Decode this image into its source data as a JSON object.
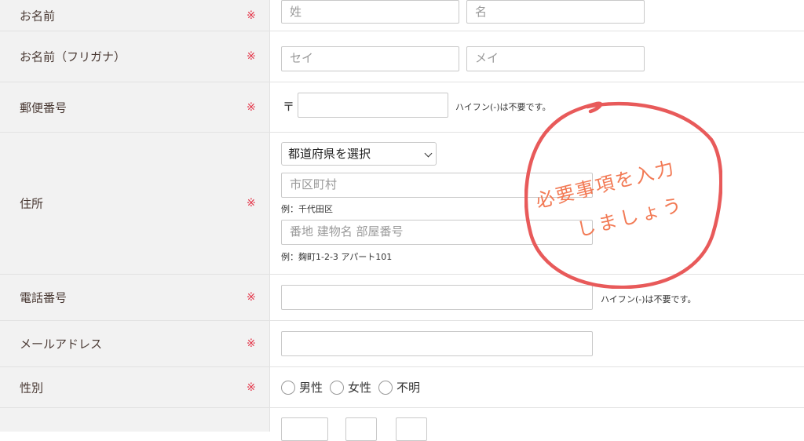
{
  "required_mark": "※",
  "fields": {
    "name": {
      "label": "お名前",
      "last_placeholder": "姓",
      "first_placeholder": "名"
    },
    "kana": {
      "label": "お名前（フリガナ）",
      "last_placeholder": "セイ",
      "first_placeholder": "メイ"
    },
    "postal": {
      "label": "郵便番号",
      "prefix": "〒",
      "value": "",
      "hint": "ハイフン(-)は不要です。"
    },
    "address": {
      "label": "住所",
      "prefecture_selected": "都道府県を選択",
      "city_placeholder": "市区町村",
      "city_example": "例：千代田区",
      "street_placeholder": "番地 建物名 部屋番号",
      "street_example": "例：麹町1-2-3 アパート101"
    },
    "phone": {
      "label": "電話番号",
      "value": "",
      "hint": "ハイフン(-)は不要です。"
    },
    "email": {
      "label": "メールアドレス",
      "value": ""
    },
    "gender": {
      "label": "性別",
      "options": [
        "男性",
        "女性",
        "不明"
      ]
    }
  },
  "annotation": {
    "line1": "必要事項を入力",
    "line2": "しましょう",
    "color": "#e85a5a"
  },
  "colors": {
    "required": "#e4384b",
    "label_bg": "#f2f2f2",
    "annotation_text": "#f27a55"
  }
}
